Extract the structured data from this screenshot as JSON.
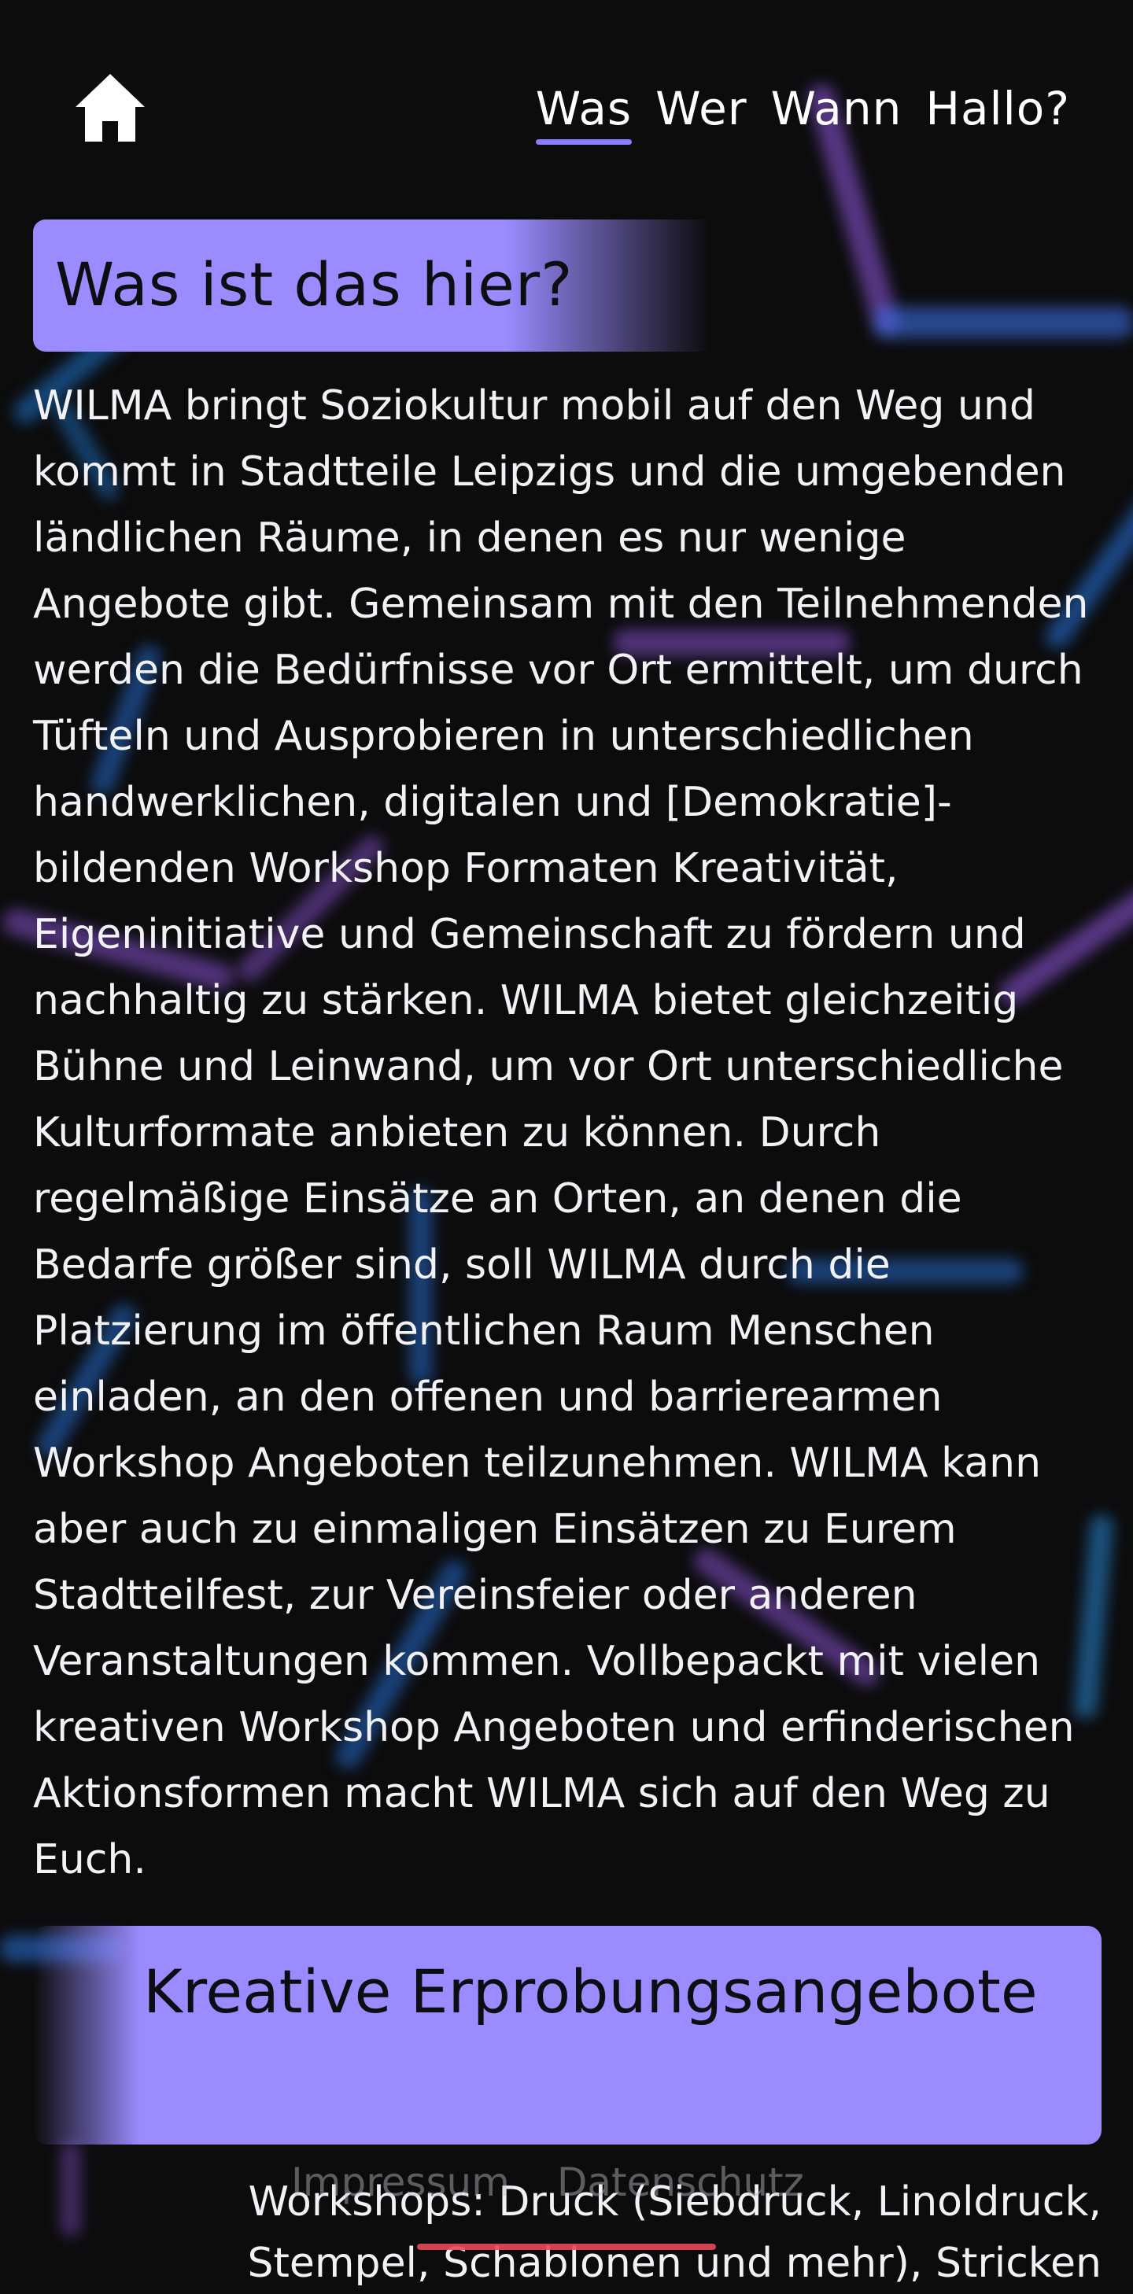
{
  "nav": {
    "home_icon": "home-icon",
    "items": [
      {
        "label": "Was",
        "active": true
      },
      {
        "label": "Wer",
        "active": false
      },
      {
        "label": "Wann",
        "active": false
      },
      {
        "label": "Hallo?",
        "active": false
      }
    ]
  },
  "intro": {
    "title": "Was ist das hier?",
    "text": "WILMA bringt Soziokultur mobil auf den Weg und kommt in Stadtteile Leipzigs und die umgebenden ländlichen Räume, in denen es nur wenige Angebote gibt. Gemeinsam mit den Teilnehmenden werden die Bedürfnisse vor Ort ermittelt, um durch Tüfteln und Ausprobieren in unterschiedlichen handwerklichen, digitalen und [Demokratie]-bildenden Workshop Formaten Kreativität, Eigeninitiative und Gemeinschaft zu fördern und nachhaltig zu stärken. WILMA bietet gleichzeitig Bühne und Leinwand, um vor Ort unterschiedliche Kulturformate anbieten zu können. Durch regelmäßige Einsätze an Orten, an denen die Bedarfe größer sind, soll WILMA durch die Platzierung im öffentlichen Raum Menschen einladen, an den offenen und barrierearmen Workshop Angeboten teilzunehmen. WILMA kann aber auch zu einmaligen Einsätzen zu Eurem Stadtteilfest, zur Vereinsfeier oder anderen Veranstaltungen kommen. Vollbepackt mit vielen kreativen Workshop Angeboten und erfinderischen Aktionsformen macht WILMA sich auf den Weg zu Euch."
  },
  "section": {
    "title": "Kreative Erprobungsangebote",
    "text": "Workshops: Druck (Siebdruck, Linoldruck, Stempel, Schablonen und mehr), Stricken"
  },
  "footer": {
    "impressum": "Impressum",
    "datenschutz": "Datenschutz"
  },
  "colors": {
    "background": "#0c0c0d",
    "accent": "#9a8bff",
    "footer_underline": "#e7485a"
  }
}
